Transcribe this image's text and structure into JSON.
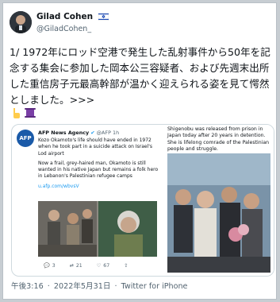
{
  "tweet": {
    "display_name": "Gilad Cohen",
    "handle": "@GiladCohen_",
    "text": "1/ 1972年にロッド空港で発生した乱射事件から50年を記念する集会に参加した岡本公三容疑者、および先週末出所した重信房子元最高幹部が温かく迎えられる姿を見て愕然としました。>>>",
    "emojis": [
      "pointing-finger",
      "scroll"
    ],
    "time": "午後3:16",
    "date": "2022年5月31日",
    "source": "Twitter for iPhone"
  },
  "quoted": {
    "logo_text": "AFP",
    "name": "AFP News Agency",
    "handle": "@AFP",
    "age": "1h",
    "para1": "Kozo Okamoto's life should have ended in 1972 when he took part in a suicide attack on Israel's Lod airport",
    "para2": "Now a frail, grey-haired man, Okamoto is still wanted in his native Japan but remains a folk hero in Lebanon's Palestinian refugee camps",
    "link": "u.afp.com/wbvsV",
    "replies": "3",
    "retweets": "21",
    "likes": "67"
  },
  "right_caption": "Shigenobu was released from prison in Japan today after 20 years in detention. She is lifelong comrade of the Palestinian people and struggle.",
  "colors": {
    "link": "#1d9bf0",
    "muted": "#536471",
    "afp_blue": "#1a5aa8"
  }
}
